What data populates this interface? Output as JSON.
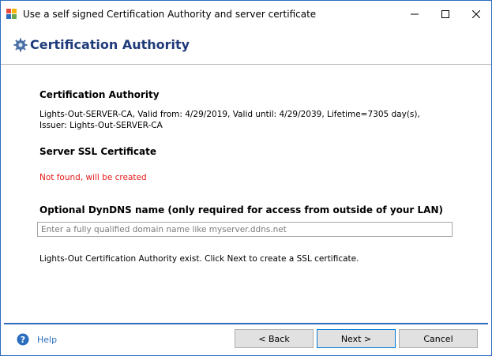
{
  "window": {
    "title": "Use a self signed Certification Authority and server certificate",
    "app_icon": "windows-app-icon",
    "controls": {
      "minimize_icon": "minimize-icon",
      "maximize_icon": "maximize-icon",
      "close_icon": "close-icon"
    }
  },
  "header": {
    "icon": "gear-icon",
    "title": "Certification Authority"
  },
  "content": {
    "ca_heading": "Certification Authority",
    "ca_details": "Lights-Out-SERVER-CA, Valid from: 4/29/2019, Valid until: 4/29/2039, Lifetime=7305 day(s), Issuer: Lights-Out-SERVER-CA",
    "ssl_heading": "Server SSL Certificate",
    "ssl_status": "Not found, will be created",
    "dyndns_heading": "Optional DynDNS name (only required for access from outside of your LAN)",
    "dyndns_input": {
      "value": "",
      "placeholder": "Enter a fully qualified domain name like myserver.ddns.net"
    },
    "info_text": "Lights-Out Certification Authority exist. Click Next to create a SSL certificate."
  },
  "footer": {
    "help_icon": "help-icon",
    "help_label": "Help",
    "back_label": "< Back",
    "next_label": "Next >",
    "cancel_label": "Cancel"
  },
  "colors": {
    "accent": "#2b6cbf",
    "header_title": "#1f3b7a",
    "error": "#e41a1a"
  }
}
